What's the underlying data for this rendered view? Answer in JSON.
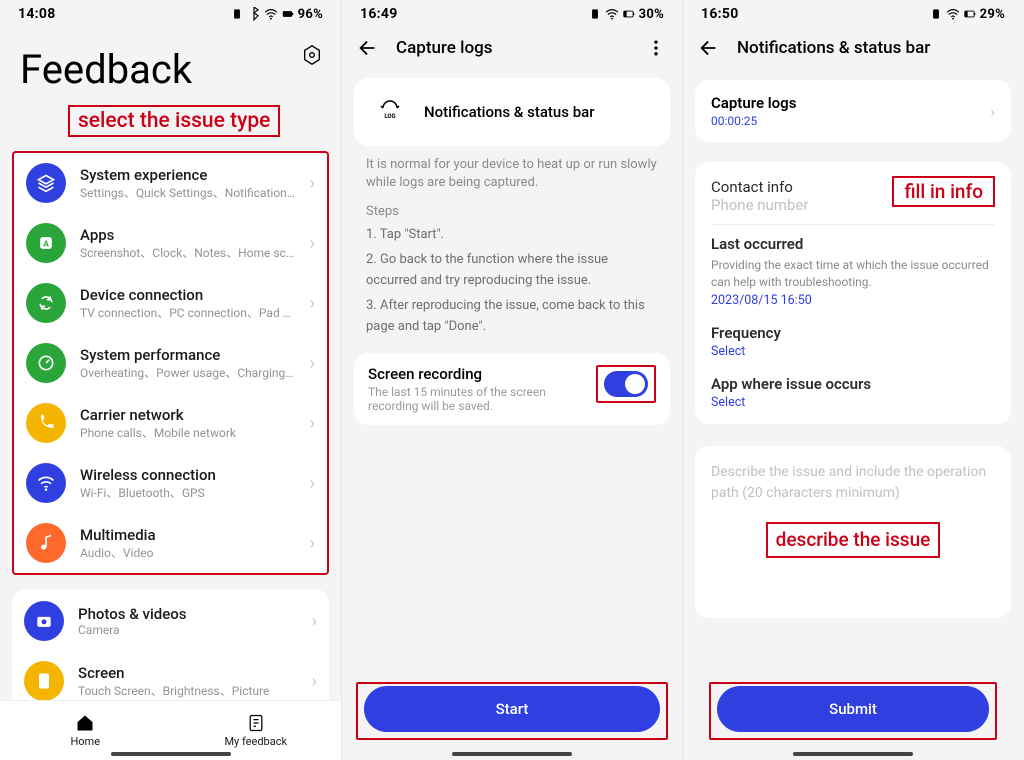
{
  "phone1": {
    "time": "14:08",
    "battery": "96%",
    "title": "Feedback",
    "callout": "select the issue type",
    "categories": [
      {
        "name": "System experience",
        "sub": "Settings、Quick Settings、Notifications & s...",
        "color": "#2f3fe0",
        "icon": "layers"
      },
      {
        "name": "Apps",
        "sub": "Screenshot、Clock、Notes、Home screen",
        "color": "#2aa53a",
        "icon": "app"
      },
      {
        "name": "Device connection",
        "sub": "TV connection、PC connection、Pad conn...",
        "color": "#2aa53a",
        "icon": "recycle"
      },
      {
        "name": "System performance",
        "sub": "Overheating、Power usage、Charging、L...",
        "color": "#2aa53a",
        "icon": "perf"
      },
      {
        "name": "Carrier network",
        "sub": "Phone calls、Mobile network",
        "color": "#f5b400",
        "icon": "phone"
      },
      {
        "name": "Wireless connection",
        "sub": "Wi-Fi、Bluetooth、GPS",
        "color": "#2f3fe0",
        "icon": "wifi"
      },
      {
        "name": "Multimedia",
        "sub": "Audio、Video",
        "color": "#ff6a2c",
        "icon": "music"
      }
    ],
    "extra": [
      {
        "name": "Photos & videos",
        "sub": "Camera",
        "color": "#2f3fe0",
        "icon": "camera"
      },
      {
        "name": "Screen",
        "sub": "Touch Screen、Brightness、Picture",
        "color": "#f5b400",
        "icon": "screen"
      }
    ],
    "tabs": {
      "home": "Home",
      "feedback": "My feedback"
    }
  },
  "phone2": {
    "time": "16:49",
    "battery": "30%",
    "title": "Capture logs",
    "card_title": "Notifications & status bar",
    "note": "It is normal for your device to heat up or run slowly while logs are being captured.",
    "steps_label": "Steps",
    "step1": "1. Tap \"Start\".",
    "step2": "2. Go back to the function where the issue occurred and try reproducing the issue.",
    "step3": "3. After reproducing the issue, come back to this page and tap \"Done\".",
    "toggle_title": "Screen recording",
    "toggle_sub": "The last 15 minutes of the screen recording will be saved.",
    "cta": "Start"
  },
  "phone3": {
    "time": "16:50",
    "battery": "29%",
    "title": "Notifications & status bar",
    "capture_label": "Capture logs",
    "capture_time": "00:00:25",
    "contact_label": "Contact info",
    "contact_ph": "Phone number",
    "fill_callout": "fill in info",
    "last_label": "Last occurred",
    "last_note": "Providing the exact time at which the issue occurred can help with troubleshooting.",
    "last_value": "2023/08/15 16:50",
    "freq_label": "Frequency",
    "select": "Select",
    "appocc_label": "App where issue occurs",
    "desc_ph": "Describe the issue and include the operation path (20 characters minimum)",
    "desc_callout": "describe the issue",
    "cta": "Submit"
  }
}
